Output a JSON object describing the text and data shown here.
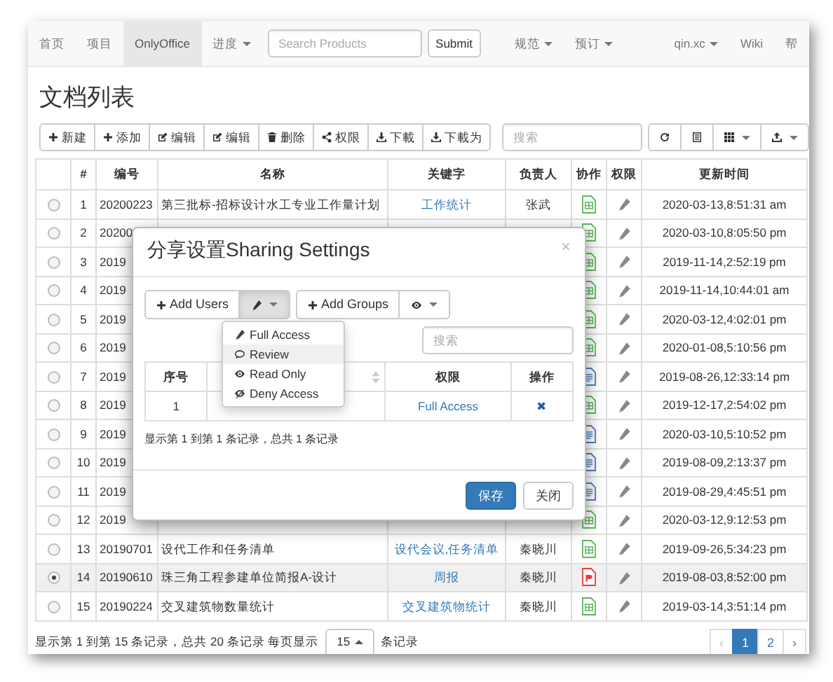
{
  "navbar": {
    "left": [
      {
        "label": "首页",
        "selected": false,
        "dropdown": false
      },
      {
        "label": "项目",
        "selected": false,
        "dropdown": false
      },
      {
        "label": "OnlyOffice",
        "selected": true,
        "dropdown": false
      },
      {
        "label": "进度",
        "selected": false,
        "dropdown": true
      }
    ],
    "search": {
      "placeholder": "Search Products"
    },
    "submit": "Submit",
    "middle": [
      {
        "label": "规范",
        "dropdown": true
      },
      {
        "label": "预订",
        "dropdown": true
      }
    ],
    "right": [
      {
        "label": "qin.xc",
        "dropdown": true
      },
      {
        "label": "Wiki",
        "dropdown": false
      },
      {
        "label": "帮",
        "dropdown": false
      }
    ]
  },
  "page_title": "文档列表",
  "toolbar": {
    "buttons": [
      {
        "kind": "add",
        "label": "新建"
      },
      {
        "kind": "add",
        "label": "添加"
      },
      {
        "kind": "edit",
        "label": "编辑"
      },
      {
        "kind": "edit",
        "label": "编辑"
      },
      {
        "kind": "delete",
        "label": "删除"
      },
      {
        "kind": "share",
        "label": "权限"
      },
      {
        "kind": "download",
        "label": "下載"
      },
      {
        "kind": "download",
        "label": "下載为"
      }
    ],
    "search": {
      "placeholder": "搜索"
    },
    "tools": [
      {
        "kind": "refresh",
        "dropdown": false
      },
      {
        "kind": "columns",
        "dropdown": false
      },
      {
        "kind": "grid",
        "dropdown": true
      },
      {
        "kind": "export",
        "dropdown": true
      }
    ]
  },
  "table": {
    "columns": [
      "#",
      "编号",
      "名称",
      "关键字",
      "负责人",
      "协作",
      "权限",
      "更新时间"
    ],
    "rows": [
      {
        "selected": false,
        "index": "1",
        "code": "20200223",
        "name": "第三批标-招标设计水工专业工作量计划",
        "keyword": "工作统计",
        "owner": "张武",
        "kind": "sheet",
        "updated": "2020-03-13,8:51:31 am"
      },
      {
        "selected": false,
        "index": "2",
        "code": "20200",
        "kind": "sheet",
        "updated": "2020-03-10,8:05:50 pm"
      },
      {
        "selected": false,
        "index": "3",
        "code": "2019",
        "kind": "sheet",
        "updated": "2019-11-14,2:52:19 pm"
      },
      {
        "selected": false,
        "index": "4",
        "code": "2019",
        "kind": "sheet",
        "updated": "2019-11-14,10:44:01 am"
      },
      {
        "selected": false,
        "index": "5",
        "code": "2019",
        "kind": "sheet",
        "updated": "2020-03-12,4:02:01 pm"
      },
      {
        "selected": false,
        "index": "6",
        "code": "2019",
        "kind": "sheet",
        "updated": "2020-01-08,5:10:56 pm"
      },
      {
        "selected": false,
        "index": "7",
        "code": "2019",
        "kind": "doc",
        "updated": "2019-08-26,12:33:14 pm"
      },
      {
        "selected": false,
        "index": "8",
        "code": "2019",
        "kind": "sheet",
        "updated": "2019-12-17,2:54:02 pm"
      },
      {
        "selected": false,
        "index": "9",
        "code": "2019",
        "kind": "doc",
        "updated": "2020-03-10,5:10:52 pm"
      },
      {
        "selected": false,
        "index": "10",
        "code": "2019",
        "kind": "doc",
        "updated": "2019-08-09,2:13:37 pm"
      },
      {
        "selected": false,
        "index": "11",
        "code": "2019",
        "kind": "doc",
        "updated": "2019-08-29,4:45:51 pm"
      },
      {
        "selected": false,
        "index": "12",
        "code": "2019",
        "kind": "sheet",
        "updated": "2020-03-12,9:12:53 pm"
      },
      {
        "selected": false,
        "index": "13",
        "code": "20190701",
        "name": "设代工作和任务清单",
        "keyword": "设代会议,任务清单",
        "owner": "秦晓川",
        "kind": "sheet",
        "updated": "2019-09-26,5:34:23 pm"
      },
      {
        "selected": true,
        "index": "14",
        "code": "20190610",
        "name": "珠三角工程参建单位简报A-设计",
        "keyword": "周报",
        "owner": "秦晓川",
        "kind": "pdf",
        "updated": "2019-08-03,8:52:00 pm"
      },
      {
        "selected": false,
        "index": "15",
        "code": "20190224",
        "name": "交叉建筑物数量统计",
        "keyword": "交叉建筑物统计",
        "owner": "秦晓川",
        "kind": "sheet",
        "updated": "2019-03-14,3:51:14 pm"
      }
    ]
  },
  "footer": {
    "summary": "显示第 1 到第 15 条记录，总共 20 条记录 每页显示",
    "page_size": "15",
    "suffix": "条记录",
    "pages": [
      {
        "label": "‹",
        "selected": false,
        "disabled": true
      },
      {
        "label": "1",
        "selected": true,
        "disabled": false
      },
      {
        "label": "2",
        "selected": false,
        "disabled": false
      },
      {
        "label": "›",
        "selected": false,
        "disabled": false
      }
    ]
  },
  "modal": {
    "title": "分享设置Sharing Settings",
    "close": "×",
    "actions": [
      {
        "kind": "add",
        "label": "Add Users"
      },
      {
        "kind": "menu",
        "open": true
      },
      {
        "kind": "add",
        "label": "Add Groups"
      },
      {
        "kind": "menu",
        "open": false
      }
    ],
    "menu": [
      {
        "kind": "full",
        "label": "Full Access",
        "hovered": false
      },
      {
        "kind": "review",
        "label": "Review",
        "hovered": true
      },
      {
        "kind": "read",
        "label": "Read Only",
        "hovered": false
      },
      {
        "kind": "deny",
        "label": "Deny Access",
        "hovered": false
      }
    ],
    "search": {
      "placeholder": "搜索"
    },
    "columns": [
      {
        "label": "序号",
        "sortable": false
      },
      {
        "sortable": true
      },
      {
        "label": "权限",
        "sortable": false
      },
      {
        "label": "操作",
        "sortable": false
      }
    ],
    "rows": [
      {
        "index": "1",
        "permission": "Full Access",
        "remove": "✖"
      }
    ],
    "summary": "显示第 1 到第 1 条记录，总共 1 条记录",
    "buttons": [
      {
        "label": "保存",
        "primary": true
      },
      {
        "label": "关闭",
        "primary": false
      }
    ]
  }
}
